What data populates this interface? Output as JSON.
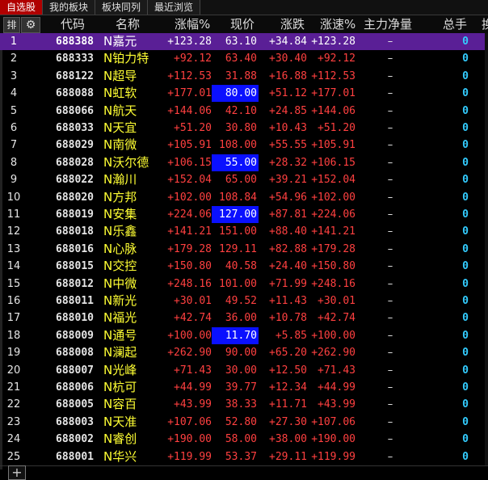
{
  "tabs": [
    "自选股",
    "我的板块",
    "板块同列",
    "最近浏览"
  ],
  "header": {
    "sort_icon": "排",
    "gear": "⚙",
    "code": "代码",
    "name": "名称",
    "chg": "涨幅%",
    "price": "现价",
    "diff": "涨跌",
    "speed": "涨速%",
    "flow": "主力净量",
    "hand": "总手",
    "more": "换"
  },
  "rows": [
    {
      "idx": "1",
      "code": "688388",
      "name": "N嘉元",
      "chg": "+123.28",
      "price": "63.10",
      "diff": "+34.84",
      "speed": "+123.28",
      "flow": "–",
      "hand": "0",
      "hl": false
    },
    {
      "idx": "2",
      "code": "688333",
      "name": "N铂力特",
      "chg": "+92.12",
      "price": "63.40",
      "diff": "+30.40",
      "speed": "+92.12",
      "flow": "–",
      "hand": "0",
      "hl": false
    },
    {
      "idx": "3",
      "code": "688122",
      "name": "N超导",
      "chg": "+112.53",
      "price": "31.88",
      "diff": "+16.88",
      "speed": "+112.53",
      "flow": "–",
      "hand": "0",
      "hl": false
    },
    {
      "idx": "4",
      "code": "688088",
      "name": "N虹软",
      "chg": "+177.01",
      "price": "80.00",
      "diff": "+51.12",
      "speed": "+177.01",
      "flow": "–",
      "hand": "0",
      "hl": true
    },
    {
      "idx": "5",
      "code": "688066",
      "name": "N航天",
      "chg": "+144.06",
      "price": "42.10",
      "diff": "+24.85",
      "speed": "+144.06",
      "flow": "–",
      "hand": "0",
      "hl": false
    },
    {
      "idx": "6",
      "code": "688033",
      "name": "N天宜",
      "chg": "+51.20",
      "price": "30.80",
      "diff": "+10.43",
      "speed": "+51.20",
      "flow": "–",
      "hand": "0",
      "hl": false
    },
    {
      "idx": "7",
      "code": "688029",
      "name": "N南微",
      "chg": "+105.91",
      "price": "108.00",
      "diff": "+55.55",
      "speed": "+105.91",
      "flow": "–",
      "hand": "0",
      "hl": false
    },
    {
      "idx": "8",
      "code": "688028",
      "name": "N沃尔德",
      "chg": "+106.15",
      "price": "55.00",
      "diff": "+28.32",
      "speed": "+106.15",
      "flow": "–",
      "hand": "0",
      "hl": true
    },
    {
      "idx": "9",
      "code": "688022",
      "name": "N瀚川",
      "chg": "+152.04",
      "price": "65.00",
      "diff": "+39.21",
      "speed": "+152.04",
      "flow": "–",
      "hand": "0",
      "hl": false
    },
    {
      "idx": "10",
      "code": "688020",
      "name": "N方邦",
      "chg": "+102.00",
      "price": "108.84",
      "diff": "+54.96",
      "speed": "+102.00",
      "flow": "–",
      "hand": "0",
      "hl": false
    },
    {
      "idx": "11",
      "code": "688019",
      "name": "N安集",
      "chg": "+224.06",
      "price": "127.00",
      "diff": "+87.81",
      "speed": "+224.06",
      "flow": "–",
      "hand": "0",
      "hl": true
    },
    {
      "idx": "12",
      "code": "688018",
      "name": "N乐鑫",
      "chg": "+141.21",
      "price": "151.00",
      "diff": "+88.40",
      "speed": "+141.21",
      "flow": "–",
      "hand": "0",
      "hl": false
    },
    {
      "idx": "13",
      "code": "688016",
      "name": "N心脉",
      "chg": "+179.28",
      "price": "129.11",
      "diff": "+82.88",
      "speed": "+179.28",
      "flow": "–",
      "hand": "0",
      "hl": false
    },
    {
      "idx": "14",
      "code": "688015",
      "name": "N交控",
      "chg": "+150.80",
      "price": "40.58",
      "diff": "+24.40",
      "speed": "+150.80",
      "flow": "–",
      "hand": "0",
      "hl": false
    },
    {
      "idx": "15",
      "code": "688012",
      "name": "N中微",
      "chg": "+248.16",
      "price": "101.00",
      "diff": "+71.99",
      "speed": "+248.16",
      "flow": "–",
      "hand": "0",
      "hl": false
    },
    {
      "idx": "16",
      "code": "688011",
      "name": "N新光",
      "chg": "+30.01",
      "price": "49.52",
      "diff": "+11.43",
      "speed": "+30.01",
      "flow": "–",
      "hand": "0",
      "hl": false
    },
    {
      "idx": "17",
      "code": "688010",
      "name": "N福光",
      "chg": "+42.74",
      "price": "36.00",
      "diff": "+10.78",
      "speed": "+42.74",
      "flow": "–",
      "hand": "0",
      "hl": false
    },
    {
      "idx": "18",
      "code": "688009",
      "name": "N通号",
      "chg": "+100.00",
      "price": "11.70",
      "diff": "+5.85",
      "speed": "+100.00",
      "flow": "–",
      "hand": "0",
      "hl": true
    },
    {
      "idx": "19",
      "code": "688008",
      "name": "N澜起",
      "chg": "+262.90",
      "price": "90.00",
      "diff": "+65.20",
      "speed": "+262.90",
      "flow": "–",
      "hand": "0",
      "hl": false
    },
    {
      "idx": "20",
      "code": "688007",
      "name": "N光峰",
      "chg": "+71.43",
      "price": "30.00",
      "diff": "+12.50",
      "speed": "+71.43",
      "flow": "–",
      "hand": "0",
      "hl": false
    },
    {
      "idx": "21",
      "code": "688006",
      "name": "N杭可",
      "chg": "+44.99",
      "price": "39.77",
      "diff": "+12.34",
      "speed": "+44.99",
      "flow": "–",
      "hand": "0",
      "hl": false
    },
    {
      "idx": "22",
      "code": "688005",
      "name": "N容百",
      "chg": "+43.99",
      "price": "38.33",
      "diff": "+11.71",
      "speed": "+43.99",
      "flow": "–",
      "hand": "0",
      "hl": false
    },
    {
      "idx": "23",
      "code": "688003",
      "name": "N天准",
      "chg": "+107.06",
      "price": "52.80",
      "diff": "+27.30",
      "speed": "+107.06",
      "flow": "–",
      "hand": "0",
      "hl": false
    },
    {
      "idx": "24",
      "code": "688002",
      "name": "N睿创",
      "chg": "+190.00",
      "price": "58.00",
      "diff": "+38.00",
      "speed": "+190.00",
      "flow": "–",
      "hand": "0",
      "hl": false
    },
    {
      "idx": "25",
      "code": "688001",
      "name": "N华兴",
      "chg": "+119.99",
      "price": "53.37",
      "diff": "+29.11",
      "speed": "+119.99",
      "flow": "–",
      "hand": "0",
      "hl": false
    }
  ],
  "selected_row": 0,
  "footer": {
    "add_button": "+"
  }
}
